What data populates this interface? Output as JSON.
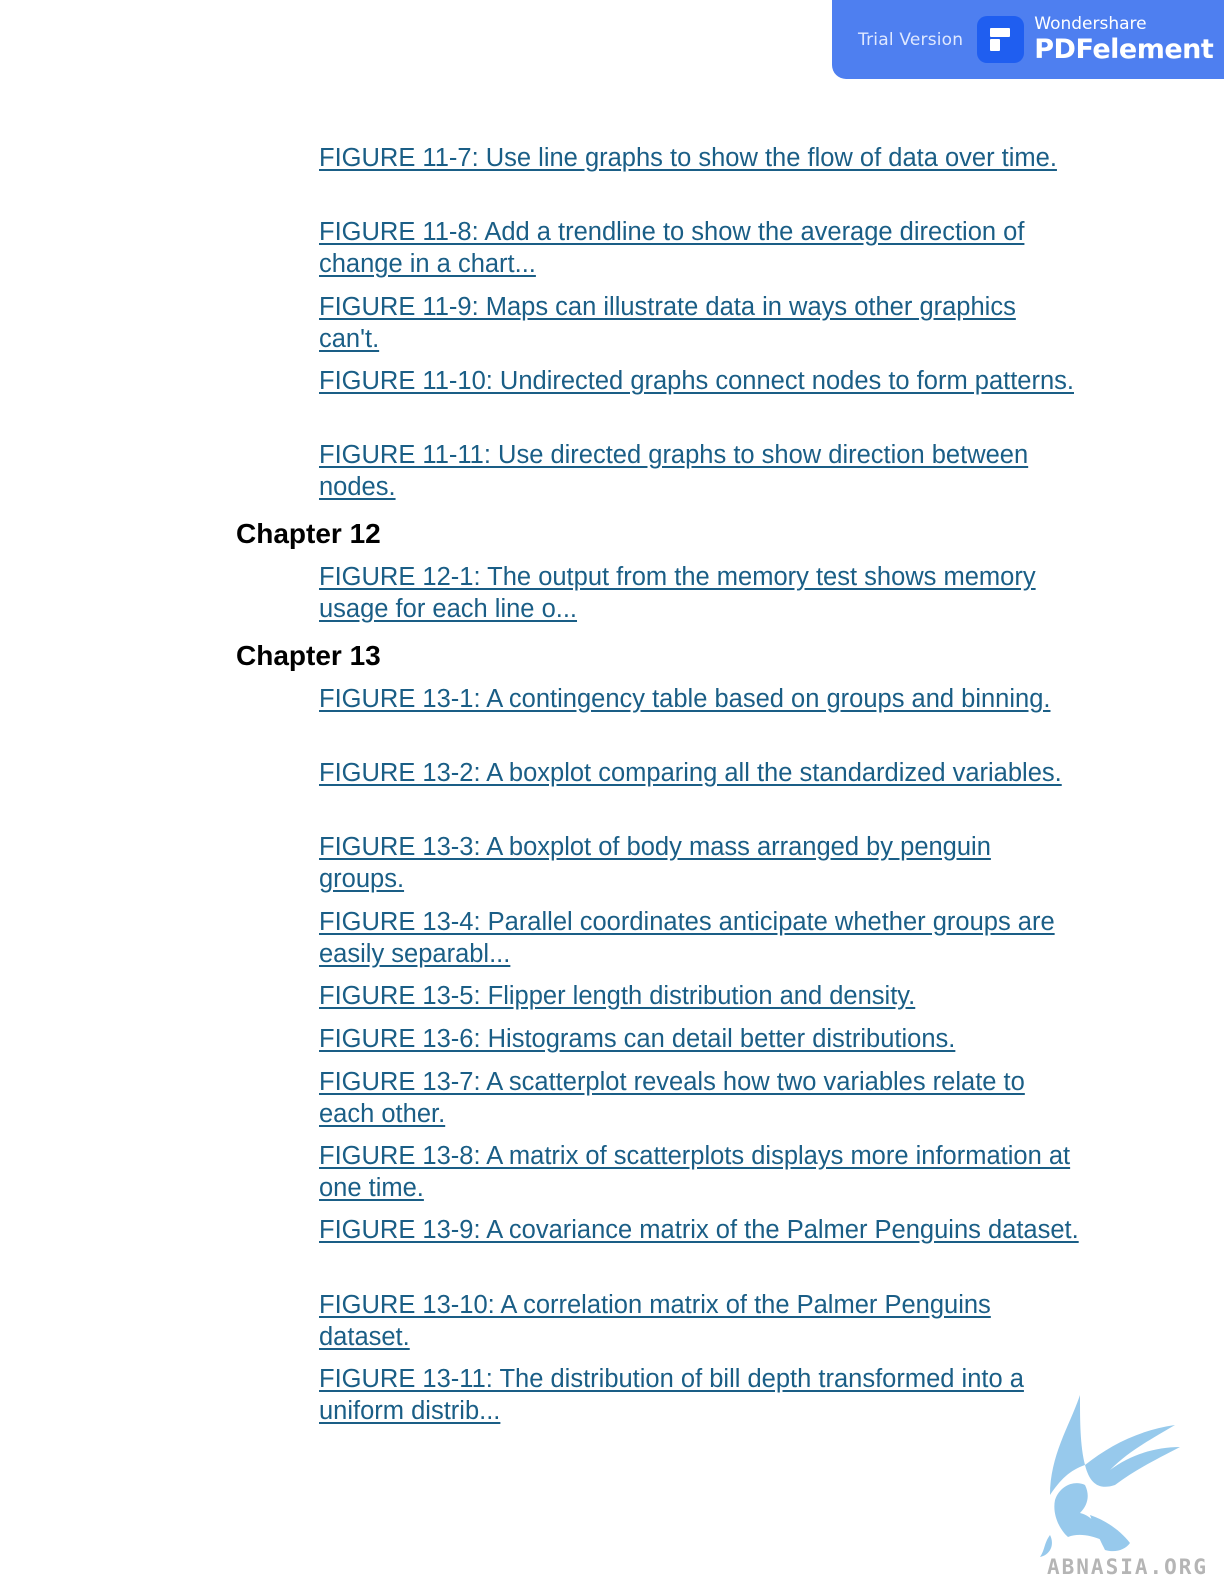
{
  "banner": {
    "trial_label": "Trial Version",
    "brand_top": "Wondershare",
    "brand_name": "PDFelement",
    "color": "#4e7ff0"
  },
  "toc": {
    "chapter11_entries": [
      "FIGURE 11-7: Use line graphs to show the flow of data over time.",
      "FIGURE 11-8: Add a trendline to show the average direction of change in a chart...",
      "FIGURE 11-9: Maps can illustrate data in ways other graphics can't.",
      "FIGURE 11-10: Undirected graphs connect nodes to form patterns.",
      "FIGURE 11-11: Use directed graphs to show direction between nodes."
    ],
    "chapter12_title": "Chapter 12",
    "chapter12_entries": [
      "FIGURE 12-1: The output from the memory test shows memory usage for each line o..."
    ],
    "chapter13_title": "Chapter 13",
    "chapter13_entries": [
      "FIGURE 13-1: A contingency table based on groups and binning.",
      "FIGURE 13-2: A boxplot comparing all the standardized variables.",
      "FIGURE 13-3: A boxplot of body mass arranged by penguin groups.",
      "FIGURE 13-4: Parallel coordinates anticipate whether groups are easily separabl...",
      "FIGURE 13-5: Flipper length distribution and density.",
      "FIGURE 13-6: Histograms can detail better distributions.",
      "FIGURE 13-7: A scatterplot reveals how two variables relate to each other.",
      "FIGURE 13-8: A matrix of scatterplots displays more information at one time.",
      "FIGURE 13-9: A covariance matrix of the Palmer Penguins dataset.",
      "FIGURE 13-10: A correlation matrix of the Palmer Penguins dataset.",
      "FIGURE 13-11: The distribution of bill depth transformed into a uniform distrib..."
    ],
    "link_color": "#1a5e86"
  },
  "watermark": {
    "text": "ABNASIA.ORG",
    "icon": "griffin-logo-icon"
  }
}
